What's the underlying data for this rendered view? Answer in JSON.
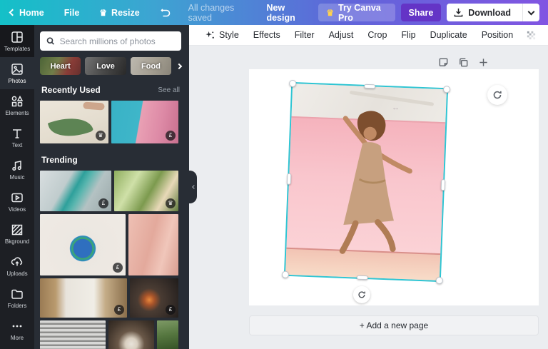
{
  "topbar": {
    "home": "Home",
    "file": "File",
    "resize": "Resize",
    "saved": "All changes saved",
    "new_design": "New design",
    "try_pro": "Try Canva Pro",
    "share": "Share",
    "download": "Download"
  },
  "sidebar": {
    "items": [
      {
        "label": "Templates"
      },
      {
        "label": "Photos"
      },
      {
        "label": "Elements"
      },
      {
        "label": "Text"
      },
      {
        "label": "Music"
      },
      {
        "label": "Videos"
      },
      {
        "label": "Bkground"
      },
      {
        "label": "Uploads"
      },
      {
        "label": "Folders"
      },
      {
        "label": "More"
      }
    ]
  },
  "panel": {
    "search_placeholder": "Search millions of photos",
    "chips": [
      {
        "label": "Heart"
      },
      {
        "label": "Love"
      },
      {
        "label": "Food"
      }
    ],
    "recently_used_title": "Recently Used",
    "see_all": "See all",
    "trending_title": "Trending"
  },
  "glyphs": {
    "crown": "♛",
    "pound": "£",
    "resize_cursor": "↔"
  },
  "toolbar": {
    "style": "Style",
    "effects": "Effects",
    "filter": "Filter",
    "adjust": "Adjust",
    "crop": "Crop",
    "flip": "Flip",
    "duplicate": "Duplicate",
    "position": "Position"
  },
  "canvas": {
    "add_page": "+ Add a new page"
  },
  "colors": {
    "gradient_start": "#14c0c8",
    "gradient_end": "#8155e2",
    "selection": "#2ec5d3",
    "panel_bg": "#282d35",
    "rail_bg": "#1d1f24",
    "canvas_bg": "#ebedf0",
    "pro_crown": "#ffd24d"
  }
}
